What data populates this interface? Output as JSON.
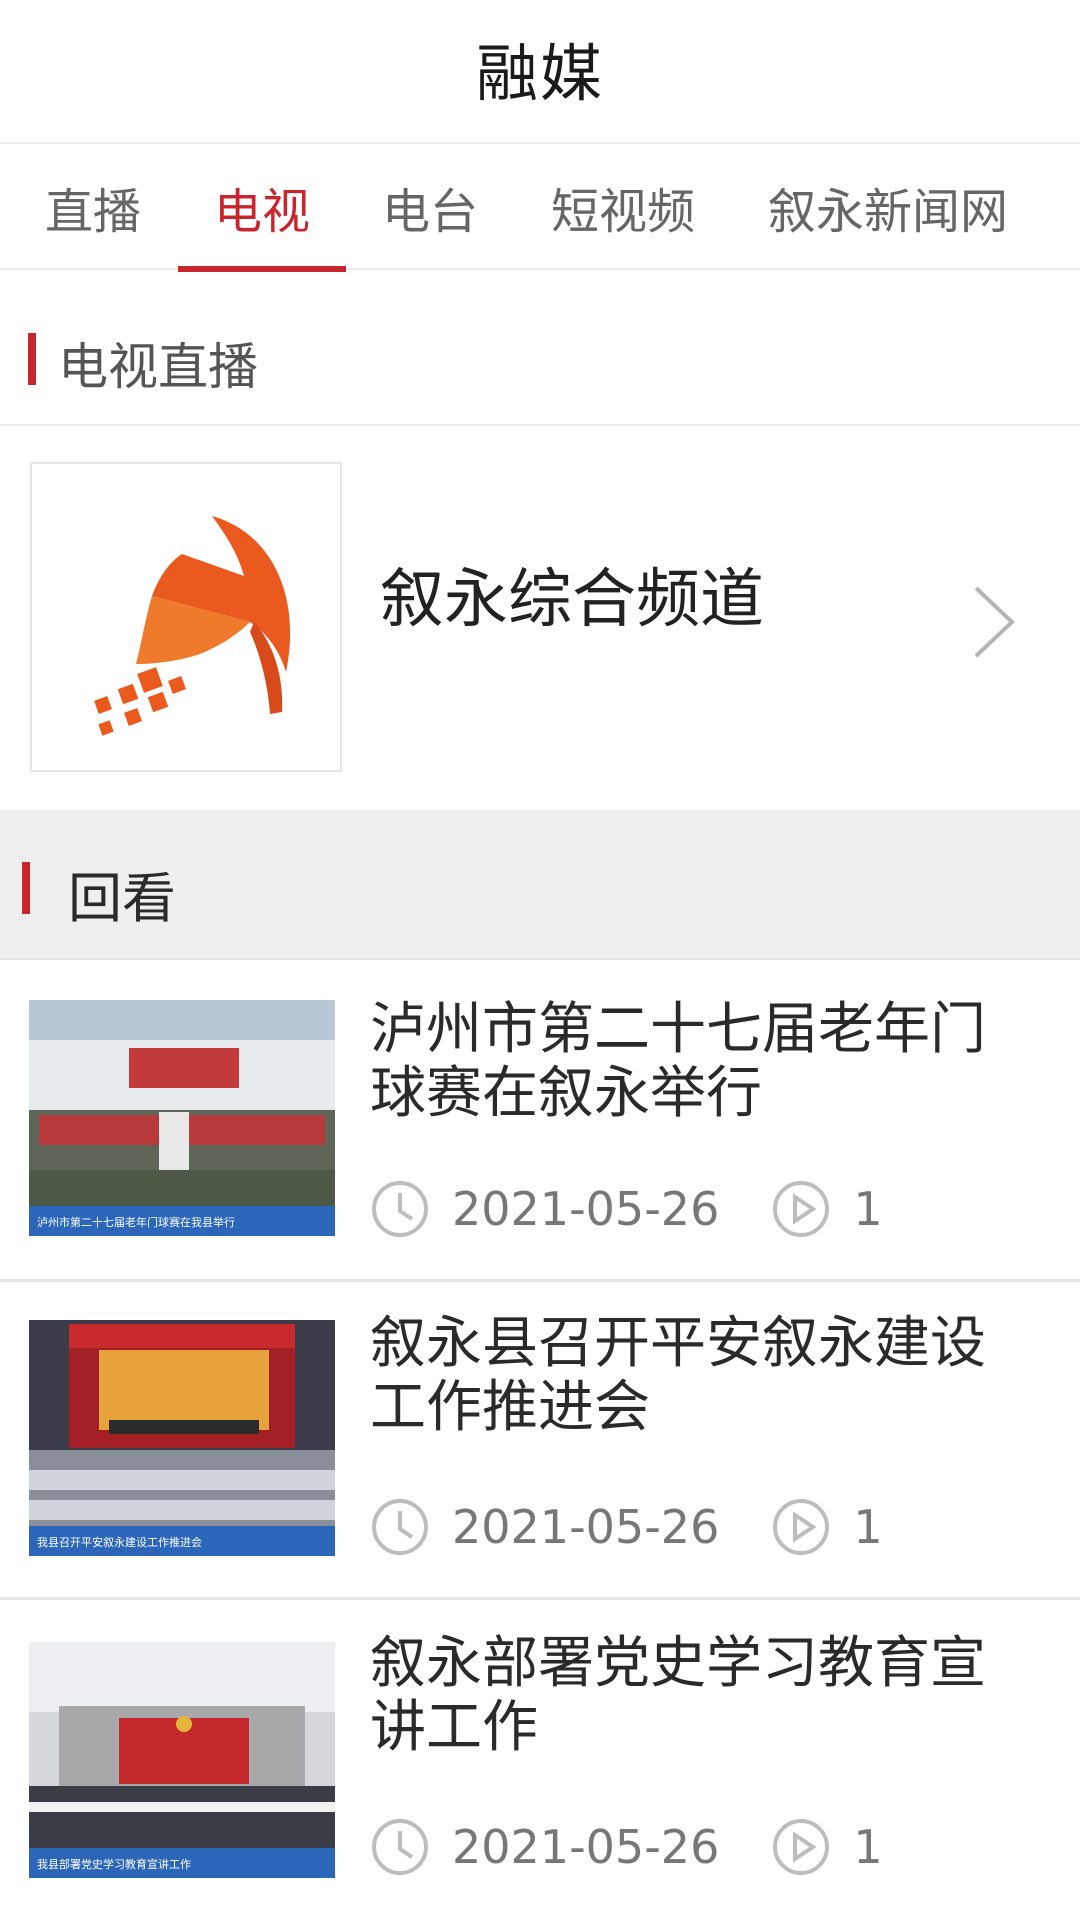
{
  "header": {
    "title": "融媒"
  },
  "tabs": [
    {
      "label": "直播",
      "active": false
    },
    {
      "label": "电视",
      "active": true
    },
    {
      "label": "电台",
      "active": false
    },
    {
      "label": "短视频",
      "active": false
    },
    {
      "label": "叙永新闻网",
      "active": false
    }
  ],
  "live_section": {
    "title": "电视直播"
  },
  "channel": {
    "name": "叙永综合频道",
    "logo_icon": "channel-logo"
  },
  "replay_section": {
    "title": "回看"
  },
  "news": [
    {
      "title": "泸州市第二十七届老年门球赛在叙永举行",
      "date": "2021-05-26",
      "views": "1",
      "thumb_caption": "泸州市第二十七届老年门球赛在我县举行"
    },
    {
      "title": "叙永县召开平安叙永建设工作推进会",
      "date": "2021-05-26",
      "views": "1",
      "thumb_caption": "我县召开平安叙永建设工作推进会"
    },
    {
      "title": "叙永部署党史学习教育宣讲工作",
      "date": "2021-05-26",
      "views": "1",
      "thumb_caption": "我县部署党史学习教育宣讲工作"
    }
  ],
  "colors": {
    "accent": "#c9252c",
    "logo_orange": "#ea5a1e"
  }
}
